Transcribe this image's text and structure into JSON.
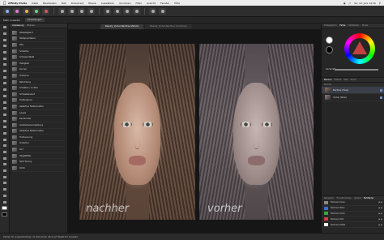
{
  "menubar": {
    "app": "Affinity Photo",
    "items": [
      "Datei",
      "Bearbeiten",
      "Text",
      "Dokument",
      "Ebene",
      "Auswählen",
      "Anordnen",
      "Filter",
      "Ansicht",
      "Fenster",
      "Hilfe"
    ],
    "clock": "Sa. 10. Juni 14:16"
  },
  "contextbar": {
    "label": "Mehr Auswahl",
    "chip": "Einstellungen"
  },
  "adjustments": {
    "tabs": [
      "Anpassung",
      "Ebenen"
    ],
    "items": [
      "Weißabgleich",
      "Weißpunktierer",
      "HSL",
      "Schärfen",
      "Schwarz-Weiß",
      "Helligkeit",
      "Kurven",
      "Tonkurve",
      "Belichtung",
      "Schatten / Lichter",
      "Schwellenwert",
      "Farbbalance",
      "Selektive Farbkorrektur",
      "Levels",
      "Kanalmixer",
      "Gradientenumsetzung",
      "Selektive Farbkorrektur",
      "Tontrennung",
      "Schärfen",
      "LUT",
      "Objektfilter",
      "Split Toning",
      "OCIO"
    ]
  },
  "document": {
    "tabs": [
      "Beauty_Vorher-Nachher.afphoto",
      "Beauty_Vorher-Nachher (Vorschau)"
    ],
    "active_tab": 0,
    "left_caption": "nachher",
    "right_caption": "vorher"
  },
  "statusbar": {
    "text": "Ziehen für Auswahlrahmen im Dokument. Klick auf Objekt für Auswahl."
  },
  "rightpanel": {
    "tabs": [
      "Histogramm",
      "Farbe",
      "Farbfelder",
      "Pinsel"
    ],
    "active_tab": 1,
    "opacity_label": "Deckkraft",
    "opacity": 1.0,
    "layers_tabs": [
      "Ebenen",
      "Effekte",
      "Stile",
      "Stock"
    ],
    "layers_blend": "Normal",
    "layers": [
      {
        "name": "Nachher (Pixel)",
        "selected": true
      },
      {
        "name": "Vorher (Pixel)",
        "selected": false
      }
    ],
    "swatch_tabs": [
      "Navigator",
      "Transformieren",
      "Verlauf",
      "Farbfelder"
    ],
    "swatches": [
      {
        "name": "Farbraum Grau",
        "color": "#888888"
      },
      {
        "name": "Farbraum Blau",
        "color": "#3a6fd0"
      },
      {
        "name": "Farbraum Grün",
        "color": "#39a548"
      },
      {
        "name": "Farbraum Rot",
        "color": "#d04040"
      },
      {
        "name": "Farbraum Weiß",
        "color": "#ffffff"
      }
    ]
  },
  "colors": {
    "accent": "#6e8fc9",
    "canvas_bg": "#161616",
    "panel_bg": "#262626"
  }
}
